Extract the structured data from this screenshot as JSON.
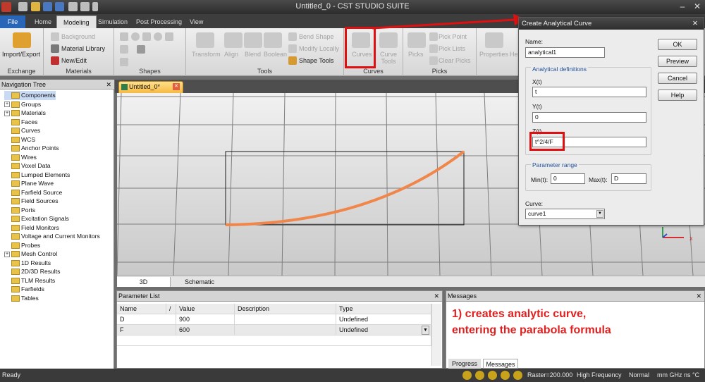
{
  "app": {
    "title": "Untitled_0 - CST STUDIO SUITE",
    "minimize": "–",
    "close": "✕"
  },
  "tabs": {
    "file": "File",
    "home": "Home",
    "modeling": "Modeling",
    "simulation": "Simulation",
    "post": "Post Processing",
    "view": "View"
  },
  "ribbon": {
    "exchange": {
      "import_export": "Import/Export",
      "group": "Exchange"
    },
    "materials": {
      "background": "Background",
      "library": "Material Library",
      "new_edit": "New/Edit",
      "group": "Materials"
    },
    "shapes": {
      "group": "Shapes"
    },
    "tools": {
      "transform": "Transform",
      "align": "Align",
      "blend": "Blend",
      "boolean": "Boolean",
      "bend_shape": "Bend Shape",
      "modify_locally": "Modify Locally",
      "shape_tools": "Shape Tools",
      "group": "Tools"
    },
    "curves": {
      "curves": "Curves",
      "curve_tools": "Curve Tools",
      "group": "Curves"
    },
    "picks": {
      "picks": "Picks",
      "pick_point": "Pick Point",
      "pick_lists": "Pick Lists",
      "clear_picks": "Clear Picks",
      "group": "Picks"
    },
    "properties": "Properties",
    "he": "He"
  },
  "nav": {
    "title": "Navigation Tree",
    "close": "✕",
    "items": [
      {
        "label": "Components",
        "expand": false,
        "sel": true
      },
      {
        "label": "Groups",
        "expand": true
      },
      {
        "label": "Materials",
        "expand": true
      },
      {
        "label": "Faces",
        "expand": false
      },
      {
        "label": "Curves",
        "expand": false
      },
      {
        "label": "WCS",
        "expand": false
      },
      {
        "label": "Anchor Points",
        "expand": false
      },
      {
        "label": "Wires",
        "expand": false
      },
      {
        "label": "Voxel Data",
        "expand": false
      },
      {
        "label": "Lumped Elements",
        "expand": false
      },
      {
        "label": "Plane Wave",
        "expand": false
      },
      {
        "label": "Farfield Source",
        "expand": false
      },
      {
        "label": "Field Sources",
        "expand": false
      },
      {
        "label": "Ports",
        "expand": false
      },
      {
        "label": "Excitation Signals",
        "expand": false
      },
      {
        "label": "Field Monitors",
        "expand": false
      },
      {
        "label": "Voltage and Current Monitors",
        "expand": false
      },
      {
        "label": "Probes",
        "expand": false
      },
      {
        "label": "Mesh Control",
        "expand": true
      },
      {
        "label": "1D Results",
        "expand": false
      },
      {
        "label": "2D/3D Results",
        "expand": false
      },
      {
        "label": "TLM Results",
        "expand": false
      },
      {
        "label": "Farfields",
        "expand": false
      },
      {
        "label": "Tables",
        "expand": false
      }
    ]
  },
  "doc": {
    "tab": "Untitled_0*",
    "close": "✕",
    "view_3d": "3D",
    "view_schematic": "Schematic"
  },
  "params": {
    "title": "Parameter List",
    "close": "✕",
    "cols": [
      "Name",
      "/",
      "Value",
      "Description",
      "Type"
    ],
    "rows": [
      [
        "D",
        "",
        "900",
        "",
        "Undefined"
      ],
      [
        "F",
        "",
        "600",
        "",
        "Undefined"
      ]
    ]
  },
  "messages": {
    "title": "Messages",
    "close": "✕",
    "annotation_line1": "1) creates analytic curve,",
    "annotation_line2": "entering the parabola formula",
    "tab_progress": "Progress",
    "tab_messages": "Messages"
  },
  "status": {
    "ready": "Ready",
    "raster": "Raster=200.000",
    "freq": "High Frequency",
    "normal": "Normal",
    "units": "mm GHz ns  °C"
  },
  "dialog": {
    "title": "Create Analytical Curve",
    "close": "✕",
    "name_label": "Name:",
    "name_value": "analytical1",
    "defs_label": "Analytical definitions",
    "x_label": "X(t)",
    "x_value": "t",
    "y_label": "Y(t)",
    "y_value": "0",
    "z_label": "Z(t)",
    "z_value": "t^2/4/F",
    "range_label": "Parameter range",
    "min_label": "Min(t):",
    "min_value": "0",
    "max_label": "Max(t):",
    "max_value": "D",
    "curve_label": "Curve:",
    "curve_value": "curve1",
    "ok": "OK",
    "preview": "Preview",
    "cancel": "Cancel",
    "help": "Help"
  },
  "colors": {
    "curve": "#f0864a",
    "highlight": "#e01010",
    "annotation": "#e02020",
    "arrow": "#e01010"
  }
}
